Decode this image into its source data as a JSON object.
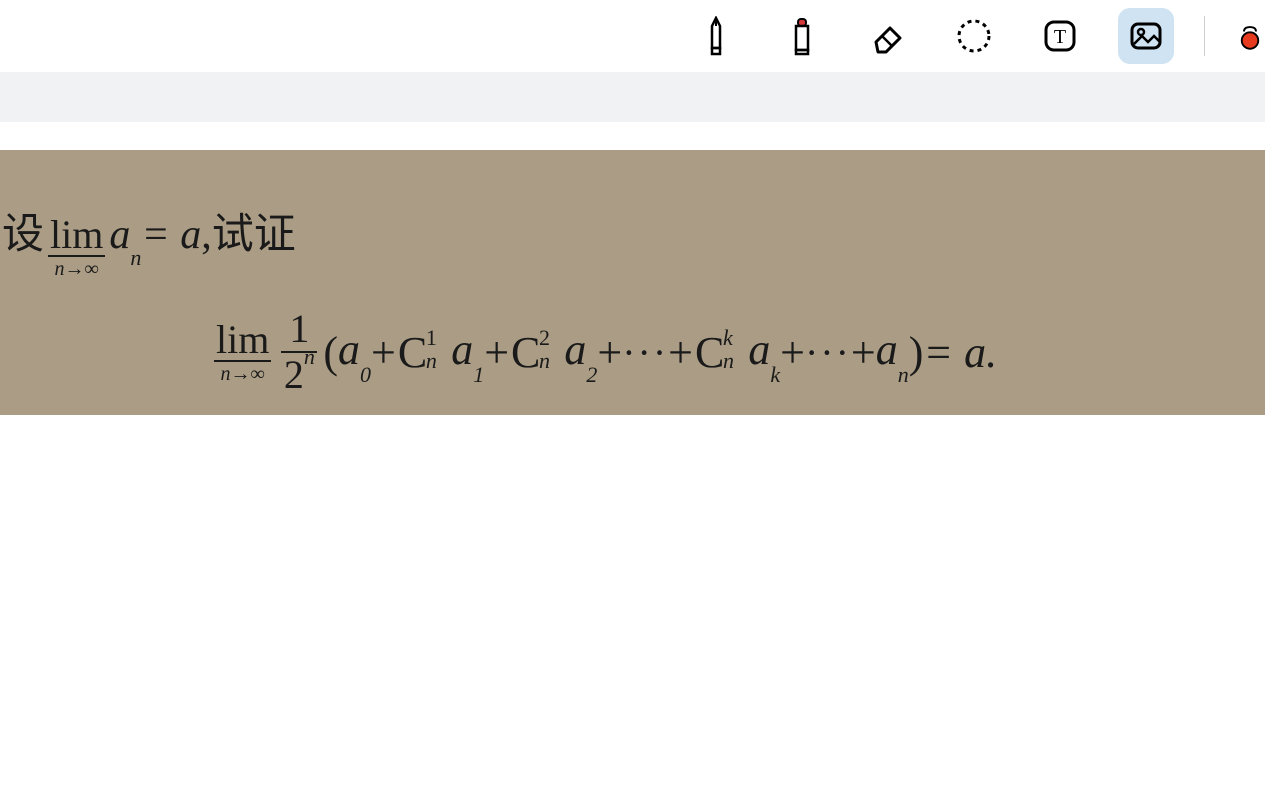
{
  "toolbar": {
    "tools": [
      {
        "name": "pen",
        "active": false
      },
      {
        "name": "highlighter",
        "active": false
      },
      {
        "name": "eraser",
        "active": false
      },
      {
        "name": "lasso",
        "active": false
      },
      {
        "name": "text",
        "active": false
      },
      {
        "name": "image",
        "active": true
      },
      {
        "name": "color",
        "active": false
      }
    ]
  },
  "math": {
    "prefix_text": "设",
    "lim_label": "lim",
    "lim_sub": "n→∞",
    "seq_var": "a",
    "seq_sub": "n",
    "equals_a": " = a",
    "suffix_text": ",试证",
    "frac_num": "1",
    "frac_den_base": "2",
    "frac_den_sup": "n",
    "open_paren": "( ",
    "term_a0_base": "a",
    "term_a0_sub": "0",
    "plus": " + ",
    "C_base": "C",
    "C1_sup": "1",
    "C1_sub": "n",
    "a1_base": "a",
    "a1_sub": "1",
    "C2_sup": "2",
    "C2_sub": "n",
    "a2_base": "a",
    "a2_sub": "2",
    "dots": " ··· ",
    "Ck_sup": "k",
    "Ck_sub": "n",
    "ak_base": "a",
    "ak_sub": "k",
    "an_base": "a",
    "an_sub": "n",
    "close_paren": " )",
    "result": " = a."
  }
}
